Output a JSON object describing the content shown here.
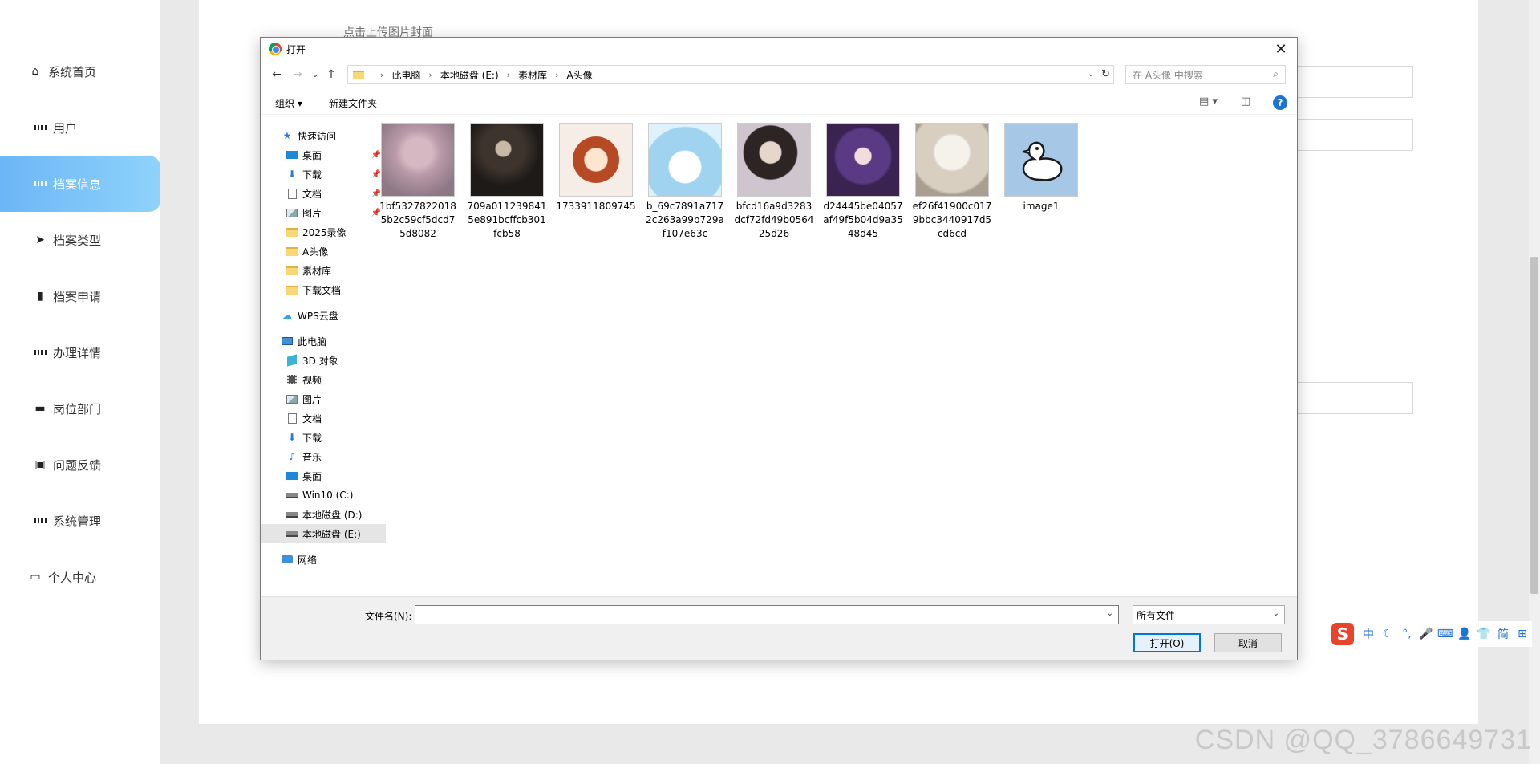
{
  "sidebar": {
    "items": [
      {
        "label": "系统首页",
        "icon": "home-icon"
      },
      {
        "label": "用户",
        "icon": "grid-icon"
      },
      {
        "label": "档案信息",
        "icon": "grid-icon",
        "active": true
      },
      {
        "label": "档案类型",
        "icon": "send-icon"
      },
      {
        "label": "档案申请",
        "icon": "book-icon"
      },
      {
        "label": "办理详情",
        "icon": "grid-icon"
      },
      {
        "label": "岗位部门",
        "icon": "monitor-icon"
      },
      {
        "label": "问题反馈",
        "icon": "clipboard-icon"
      },
      {
        "label": "系统管理",
        "icon": "grid-icon"
      },
      {
        "label": "个人中心",
        "icon": "card-icon"
      }
    ],
    "active_color": "#7cc4f8"
  },
  "main": {
    "upload_hint": "点击上传图片封面"
  },
  "dialog": {
    "title": "打开",
    "address": {
      "crumbs": [
        "此电脑",
        "本地磁盘 (E:)",
        "素材库",
        "A头像"
      ]
    },
    "search": {
      "placeholder": "在 A头像 中搜索"
    },
    "toolbar": {
      "organize": "组织 ▾",
      "new_folder": "新建文件夹"
    },
    "navpane": {
      "quick_access": "快速访问",
      "quick_items": [
        "桌面",
        "下载",
        "文档",
        "图片",
        "2025录像",
        "A头像",
        "素材库",
        "下载文档"
      ],
      "wps": "WPS云盘",
      "this_pc": "此电脑",
      "pc_items": [
        "3D 对象",
        "视频",
        "图片",
        "文档",
        "下载",
        "音乐",
        "桌面",
        "Win10 (C:)",
        "本地磁盘 (D:)",
        "本地磁盘 (E:)"
      ],
      "network": "网络"
    },
    "files": [
      {
        "name": "1bf53278220185b2c59cf5dcd75d8082"
      },
      {
        "name": "709a0112398415e891bcffcb301fcb58"
      },
      {
        "name": "1733911809745"
      },
      {
        "name": "b_69c7891a7172c263a99b729af107e63c"
      },
      {
        "name": "bfcd16a9d3283dcf72fd49b056425d26"
      },
      {
        "name": "d24445be04057af49f5b04d9a3548d45"
      },
      {
        "name": "ef26f41900c0179bbc3440917d5cd6cd"
      },
      {
        "name": "image1"
      }
    ],
    "bottom": {
      "filename_label": "文件名(N):",
      "filename_value": "",
      "filetype": "所有文件",
      "open_button": "打开(O)",
      "cancel_button": "取消"
    }
  },
  "ime": {
    "logo": "S",
    "items": [
      "中",
      "☾",
      "°,",
      "🎤",
      "⌨",
      "👤",
      "👕",
      "简",
      "⊞"
    ]
  },
  "watermark": "CSDN @QQ_3786649731"
}
